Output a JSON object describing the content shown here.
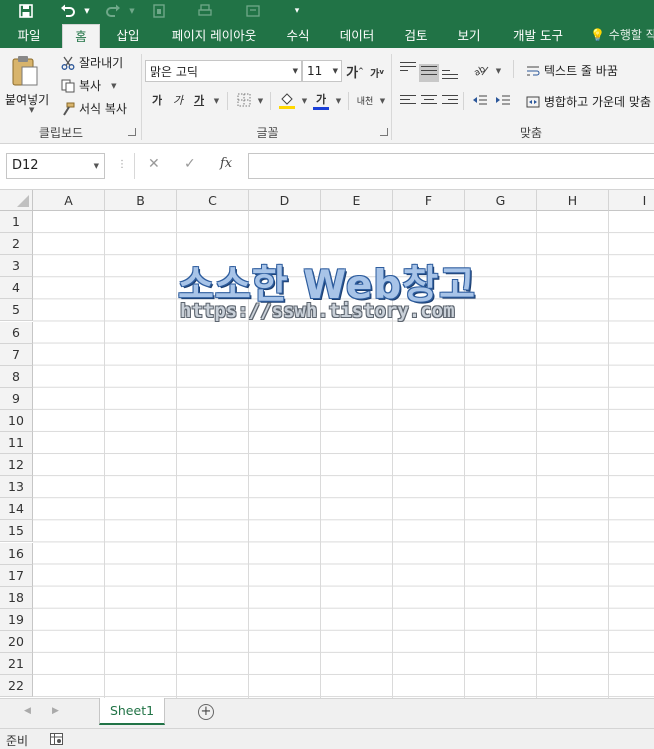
{
  "ribbon_tabs": [
    "파일",
    "홈",
    "삽입",
    "페이지 레이아웃",
    "수식",
    "데이터",
    "검토",
    "보기",
    "개발 도구"
  ],
  "active_tab": "홈",
  "tell_me": "수행할 작",
  "clipboard": {
    "paste": "붙여넣기",
    "cut": "잘라내기",
    "copy": "복사",
    "format_painter": "서식 복사",
    "group_label": "클립보드"
  },
  "font": {
    "name": "맑은 고딕",
    "size": "11",
    "grow": "가",
    "shrink": "가",
    "bold": "가",
    "italic": "가",
    "underline": "가",
    "font_color_glyph": "가",
    "phonetic": "내천",
    "group_label": "글꼴",
    "font_color": "#1a3fd8",
    "fill_color": "#ffd700"
  },
  "alignment": {
    "wrap_text": "텍스트 줄 바꿈",
    "merge_center": "병합하고 가운데 맞춤",
    "group_label": "맞춤"
  },
  "formula_bar": {
    "name_box": "D12",
    "fx": "fx",
    "value": ""
  },
  "columns": [
    "A",
    "B",
    "C",
    "D",
    "E",
    "F",
    "G",
    "H",
    "I"
  ],
  "rows": [
    "1",
    "2",
    "3",
    "4",
    "5",
    "6",
    "7",
    "8",
    "9",
    "10",
    "11",
    "12",
    "13",
    "14",
    "15",
    "16",
    "17",
    "18",
    "19",
    "20",
    "21",
    "22"
  ],
  "watermark": {
    "title": "소소한 Web창고",
    "url": "https://sswh.tistory.com"
  },
  "sheets": [
    "Sheet1"
  ],
  "status": {
    "mode": "준비"
  },
  "colors": {
    "excel_green": "#217346"
  }
}
